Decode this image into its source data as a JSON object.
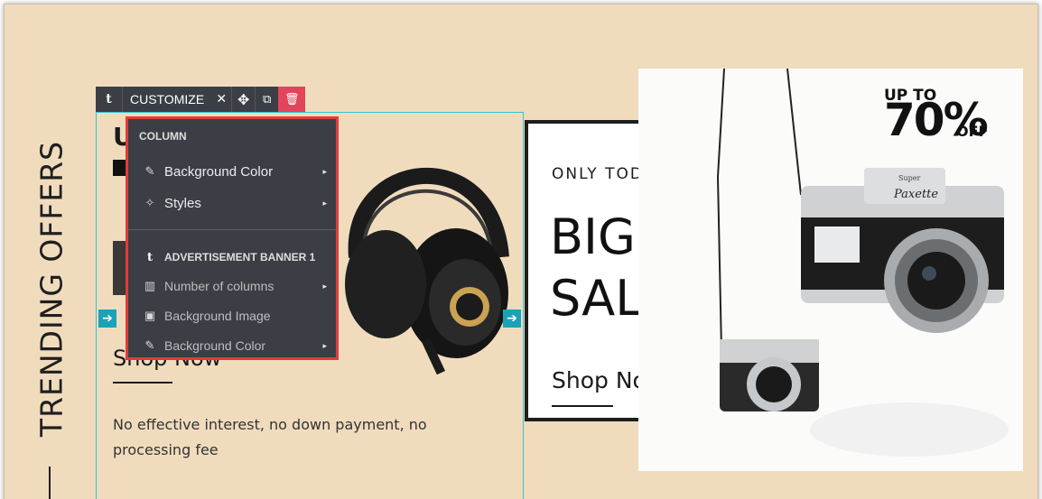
{
  "section": {
    "vertical_title": "TRENDING OFFERS"
  },
  "column1": {
    "heading_fragment": "U",
    "shop_link": "Shop Now",
    "description": "No effective interest, no down payment, no processing fee"
  },
  "toolbar": {
    "logo": "t",
    "customize_label": "CUSTOMIZE",
    "close_glyph": "✕",
    "move_glyph": "✥",
    "duplicate_glyph": "⧉",
    "delete_glyph": "🗑"
  },
  "context_menu": {
    "section1_title": "COLUMN",
    "section1_items": [
      {
        "label": "Background Color",
        "icon": "eyedropper-icon",
        "glyph": "✎"
      },
      {
        "label": "Styles",
        "icon": "magic-wand-icon",
        "glyph": "✧"
      }
    ],
    "section2_logo": "t",
    "section2_title": "ADVERTISEMENT BANNER 1",
    "section2_items": [
      {
        "label": "Number of columns",
        "icon": "columns-icon",
        "glyph": "▥"
      },
      {
        "label": "Background Image",
        "icon": "image-icon",
        "glyph": "▣"
      },
      {
        "label": "Background Color",
        "icon": "eyedropper-icon",
        "glyph": "✎"
      }
    ],
    "caret": "▸"
  },
  "sale_card": {
    "kicker": "ONLY TODAY",
    "headline_line1": "BIG",
    "headline_line2": "SALE",
    "shop_link": "Shop Now"
  },
  "camera_banner": {
    "promo_upto": "UP TO",
    "promo_percent": "70%",
    "promo_off": "OFF",
    "camera_brand": "Paxette",
    "camera_brand_small": "Super"
  },
  "arrows": {
    "glyph": "➔"
  },
  "colors": {
    "background": "#f0dcbd",
    "toolbar": "#3b3f45",
    "delete": "#e2445c",
    "menu_border": "#e03b3b",
    "selection_outline": "#35c2d1",
    "arrow": "#1aa2b8"
  }
}
